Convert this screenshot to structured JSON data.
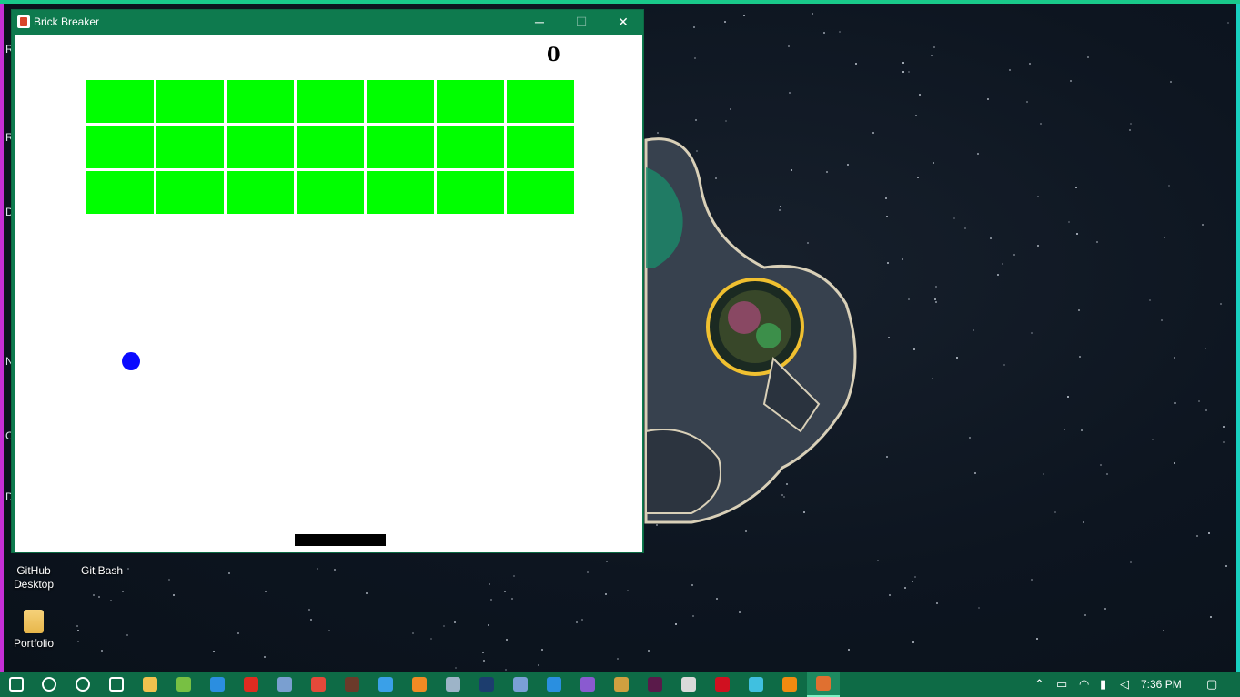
{
  "window": {
    "title": "Brick Breaker",
    "minimize": "─",
    "maximize": "☐",
    "close": "✕"
  },
  "game": {
    "score": "0",
    "brick_rows": 3,
    "brick_cols": 7,
    "colors": {
      "brick": "#00ff00",
      "ball": "#0a0aff",
      "paddle": "#000000",
      "background": "#ffffff"
    }
  },
  "desktop": {
    "icons": [
      {
        "label_line1": "GitHub",
        "label_line2": "Desktop",
        "icon": "github-desktop-icon"
      },
      {
        "label_line1": "Git Bash",
        "label_line2": "",
        "icon": "git-bash-icon"
      },
      {
        "label_line1": "Portfolio",
        "label_line2": "",
        "icon": "folder-icon"
      }
    ],
    "edge_letters": [
      "R",
      "R",
      "D",
      "N",
      "C",
      "D"
    ]
  },
  "taskbar": {
    "apps": [
      {
        "name": "start-icon",
        "color": "#ffffff"
      },
      {
        "name": "search-icon",
        "color": "#ffffff"
      },
      {
        "name": "cortana-icon",
        "color": "#ffffff"
      },
      {
        "name": "task-view-icon",
        "color": "#ffffff"
      },
      {
        "name": "file-explorer-icon",
        "color": "#f2c14e"
      },
      {
        "name": "utorrent-icon",
        "color": "#78c043"
      },
      {
        "name": "mail-icon",
        "color": "#2b8ee0"
      },
      {
        "name": "acrobat-icon",
        "color": "#e02b20"
      },
      {
        "name": "virtualbox-icon",
        "color": "#7a9fd0"
      },
      {
        "name": "chrome-icon",
        "color": "#e4493a"
      },
      {
        "name": "game-icon",
        "color": "#6b3a2a"
      },
      {
        "name": "edge-icon",
        "color": "#3aa0e8"
      },
      {
        "name": "firefox-icon",
        "color": "#f08a24"
      },
      {
        "name": "remote-desktop-icon",
        "color": "#9db4c8"
      },
      {
        "name": "photoshop-icon",
        "color": "#1c3d6e"
      },
      {
        "name": "r-icon",
        "color": "#7a9fd6"
      },
      {
        "name": "vscode-icon",
        "color": "#2a8fe0"
      },
      {
        "name": "twitch-icon",
        "color": "#8a5ad0"
      },
      {
        "name": "git-icon",
        "color": "#d0a040"
      },
      {
        "name": "xd-icon",
        "color": "#5a1a4a"
      },
      {
        "name": "store-icon",
        "color": "#dadada"
      },
      {
        "name": "netflix-icon",
        "color": "#d01020"
      },
      {
        "name": "vpn-icon",
        "color": "#40c0e0"
      },
      {
        "name": "vlc-icon",
        "color": "#f08a10"
      },
      {
        "name": "java-icon",
        "color": "#e07030"
      }
    ],
    "clock": "7:36 PM"
  }
}
